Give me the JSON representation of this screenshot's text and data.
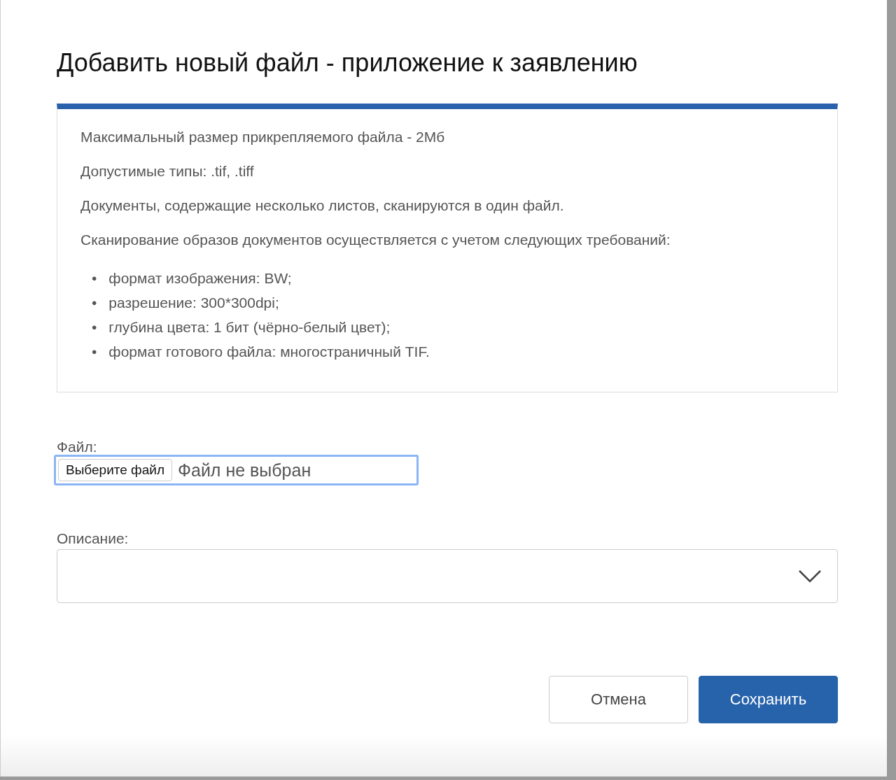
{
  "dialog": {
    "title": "Добавить новый файл - приложение к заявлению"
  },
  "notice": {
    "paragraphs": [
      "Максимальный размер прикрепляемого файла - 2Мб",
      "Допустимые типы: .tif, .tiff",
      "Документы, содержащие несколько листов, сканируются в один файл.",
      "Сканирование образов документов осуществляется с учетом следующих требований:"
    ],
    "bullets": [
      {
        "marker": "•",
        "text": "формат изображения: BW;"
      },
      {
        "marker": "•",
        "text": "разрешение: 300*300dpi;"
      },
      {
        "marker": "•",
        "text": "глубина цвета: 1 бит (чёрно-белый цвет);"
      },
      {
        "marker": "•",
        "text": "формат готового файла: многостраничный TIF."
      }
    ]
  },
  "file_field": {
    "label": "Файл:",
    "button": "Выберите файл",
    "status": "Файл не выбран",
    "focused": true
  },
  "description_field": {
    "label": "Описание:"
  },
  "buttons": [
    {
      "label": "Отмена",
      "kind": "secondary"
    },
    {
      "label": "Сохранить",
      "kind": "primary"
    }
  ]
}
